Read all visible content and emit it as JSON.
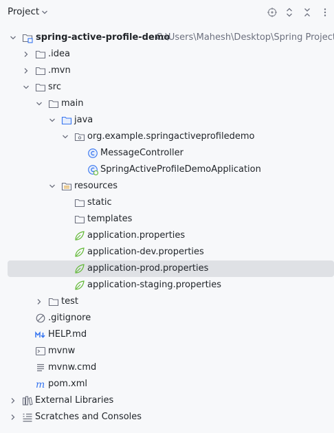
{
  "header": {
    "title": "Project",
    "icons": [
      "chevron-down-icon",
      "locate-icon",
      "expand-all-icon",
      "close-icon",
      "more-icon"
    ]
  },
  "tree": {
    "root": {
      "name": "spring-active-profile-demo",
      "path": "C:\\Users\\Mahesh\\Desktop\\Spring Project"
    },
    "idea": ".idea",
    "mvn": ".mvn",
    "src": "src",
    "main": "main",
    "java": "java",
    "package": "org.example.springactiveprofiledemo",
    "message_controller": "MessageController",
    "application_class": "SpringActiveProfileDemoApplication",
    "resources": "resources",
    "static": "static",
    "templates": "templates",
    "app_props": "application.properties",
    "app_dev_props": "application-dev.properties",
    "app_prod_props": "application-prod.properties",
    "app_staging_props": "application-staging.properties",
    "test": "test",
    "gitignore": ".gitignore",
    "help": "HELP.md",
    "mvnw": "mvnw",
    "mvnw_cmd": "mvnw.cmd",
    "pom": "pom.xml",
    "external_libraries": "External Libraries",
    "scratches": "Scratches and Consoles"
  },
  "selected_item": "application-prod.properties",
  "colors": {
    "background": "#f7f8fa",
    "selection": "#dfe1e5",
    "path_text": "#6c707e",
    "java_blue": "#3574f0",
    "spring_green": "#5fb832"
  }
}
